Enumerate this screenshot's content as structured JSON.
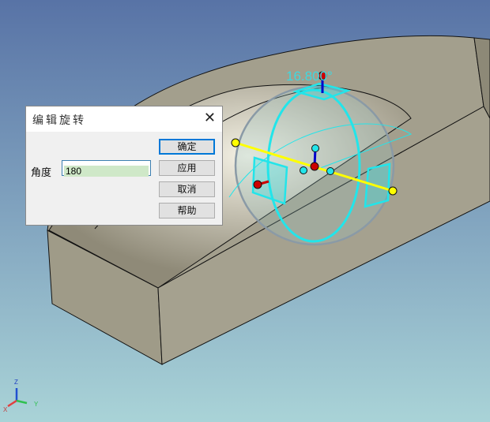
{
  "viewport": {
    "angle_readout": "16.800°",
    "axes": {
      "x": "X",
      "y": "Y",
      "z": "Z"
    }
  },
  "dialog": {
    "title": "编辑旋转",
    "close_icon": "close-icon",
    "angle_label": "角度",
    "angle_value": "180",
    "buttons": {
      "ok": "确定",
      "apply": "应用",
      "cancel": "取消",
      "help": "帮助"
    }
  },
  "colors": {
    "gizmo": "#22e5ea",
    "axis_line": "#ffff00",
    "handle": "#cc0000",
    "background_top": "#5873a6",
    "background_bottom": "#a9d3d7"
  }
}
